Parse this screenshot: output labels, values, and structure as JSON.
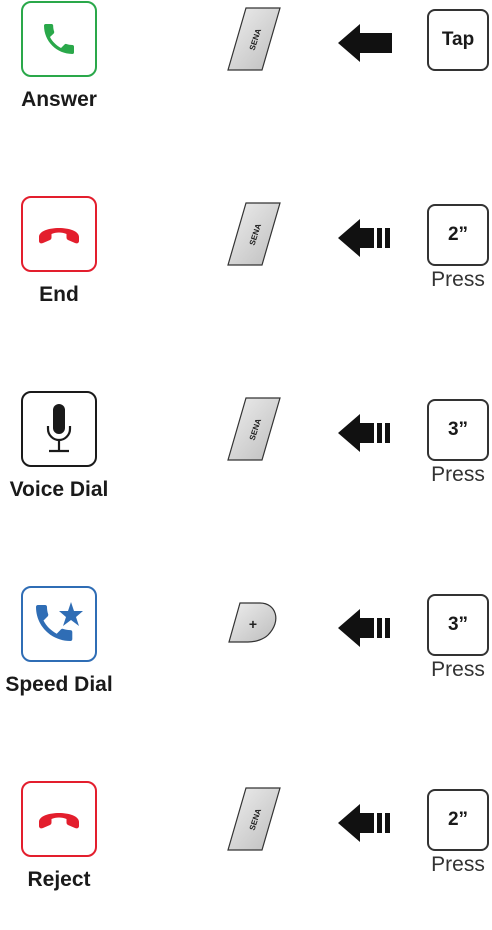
{
  "rows": [
    {
      "label": "Answer",
      "icon": "phone-answer-icon",
      "icon_color": "#2aa84a",
      "button": "sena-logo-button",
      "button_text": "SENA",
      "arrow": "tap-arrow",
      "action": "Tap",
      "action_sub": ""
    },
    {
      "label": "End",
      "icon": "phone-hangup-icon",
      "icon_color": "#e31e2d",
      "button": "sena-logo-button",
      "button_text": "SENA",
      "arrow": "press-arrow",
      "action": "2”",
      "action_sub": "Press"
    },
    {
      "label": "Voice Dial",
      "icon": "microphone-icon",
      "icon_color": "#1a1a1a",
      "button": "sena-logo-button",
      "button_text": "SENA",
      "arrow": "press-arrow",
      "action": "3”",
      "action_sub": "Press"
    },
    {
      "label": "Speed Dial",
      "icon": "phone-star-icon",
      "icon_color": "#2f6db5",
      "button": "plus-button",
      "button_text": "+",
      "arrow": "press-arrow",
      "action": "3”",
      "action_sub": "Press"
    },
    {
      "label": "Reject",
      "icon": "phone-hangup-icon",
      "icon_color": "#e31e2d",
      "button": "sena-logo-button",
      "button_text": "SENA",
      "arrow": "press-arrow",
      "action": "2”",
      "action_sub": "Press"
    }
  ]
}
